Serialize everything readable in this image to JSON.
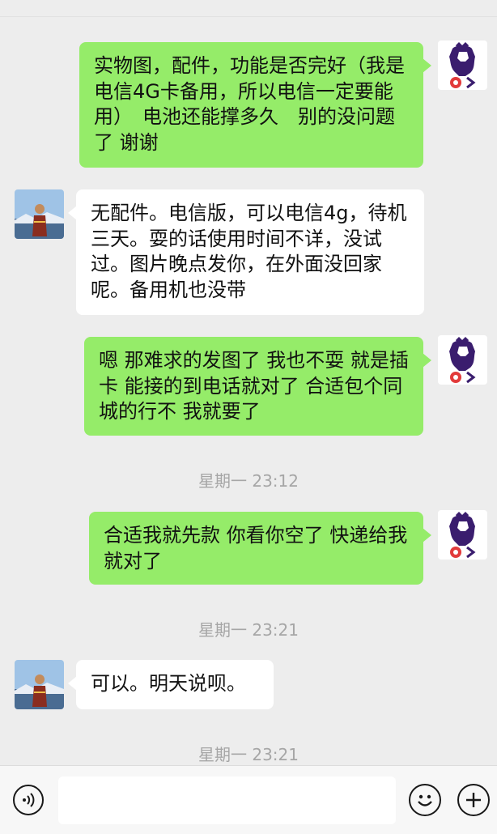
{
  "messages": [
    {
      "side": "me",
      "text": "实物图，配件，功能是否完好（我是电信4G卡备用，所以电信一定要能用）　电池还能撑多久　别的没问题了 谢谢"
    },
    {
      "side": "other",
      "text": "无配件。电信版，可以电信4g，待机三天。耍的话使用时间不详，没试过。图片晚点发你，在外面没回家呢。备用机也没带"
    },
    {
      "side": "me",
      "text": "嗯 那难求的发图了 我也不耍 就是插卡 能接的到电话就对了 合适包个同城的行不 我就要了"
    },
    {
      "side": "me",
      "text": "合适我就先款 你看你空了 快递给我就对了"
    },
    {
      "side": "other",
      "text": "可以。明天说呗。"
    }
  ],
  "timestamps": [
    "星期一 23:12",
    "星期一 23:21",
    "星期一 23:21"
  ],
  "input": {
    "value": ""
  },
  "icons": {
    "voice": "voice-icon",
    "emoji": "emoji-icon",
    "add": "add-icon"
  },
  "colors": {
    "me_bubble": "#95ec69",
    "other_bubble": "#ffffff",
    "background": "#ededed"
  }
}
